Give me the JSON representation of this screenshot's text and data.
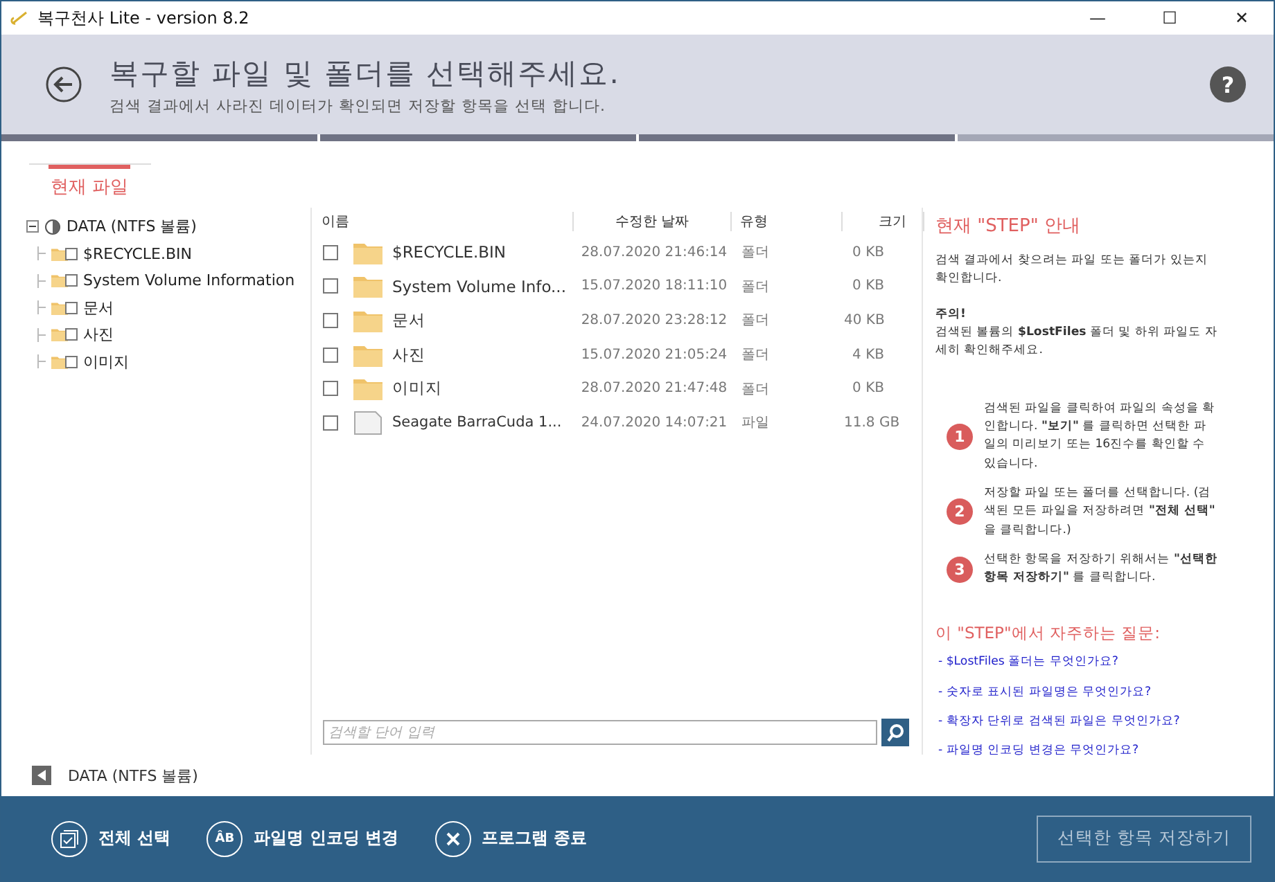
{
  "window": {
    "title": "복구천사 Lite - version 8.2",
    "controls": [
      "—",
      "☐",
      "✕"
    ]
  },
  "header": {
    "title": "복구할 파일 및 폴더를 선택해주세요.",
    "subtitle": "검색 결과에서 사라진 데이터가 확인되면 저장할 항목을 선택 합니다.",
    "help": "?"
  },
  "progress_steps": [
    {
      "done": true
    },
    {
      "done": true
    },
    {
      "done": true
    },
    {
      "done": false
    }
  ],
  "tabs": [
    {
      "label": "현재 파일",
      "selected": true
    }
  ],
  "tree": {
    "label": "DATA (NTFS 볼륨)",
    "expanded": true,
    "children": [
      {
        "label": "$RECYCLE.BIN",
        "checked": false
      },
      {
        "label": "System Volume Information",
        "checked": false
      },
      {
        "label": "문서",
        "checked": false
      },
      {
        "label": "사진",
        "checked": false
      },
      {
        "label": "이미지",
        "checked": false
      }
    ]
  },
  "table": {
    "columns": [
      "이름",
      "수정한 날짜",
      "유형",
      "크기"
    ],
    "rows": [
      {
        "kind": "folder",
        "checked": false,
        "name": "$RECYCLE.BIN",
        "date": "28.07.2020 21:46:14",
        "type": "폴더",
        "size": "0 KB"
      },
      {
        "kind": "folder",
        "checked": false,
        "name": "System Volume Info...",
        "date": "15.07.2020 18:11:10",
        "type": "폴더",
        "size": "0 KB"
      },
      {
        "kind": "folder",
        "checked": false,
        "name": "문서",
        "date": "28.07.2020 23:28:12",
        "type": "폴더",
        "size": "40 KB"
      },
      {
        "kind": "folder",
        "checked": false,
        "name": "사진",
        "date": "15.07.2020 21:05:24",
        "type": "폴더",
        "size": "4 KB"
      },
      {
        "kind": "folder",
        "checked": false,
        "name": "이미지",
        "date": "28.07.2020 21:47:48",
        "type": "폴더",
        "size": "0 KB"
      },
      {
        "kind": "file",
        "checked": false,
        "name": "Seagate BarraCuda 1...",
        "date": "24.07.2020 14:07:21",
        "type": "파일",
        "size": "11.8 GB"
      }
    ]
  },
  "search": {
    "placeholder": "검색할 단어 입력"
  },
  "guide": {
    "title": "현재 \"STEP\" 안내",
    "intro": "검색 결과에서 찾으려는 파일 또는 폴더가 있는지 확인합니다.",
    "note_title": "주의!",
    "note": "검색된 볼륨의 **$LostFiles** 폴더 및 하위 파일도 자세히 확인해주세요.",
    "steps": [
      {
        "number": "1",
        "text": "검색된 파일을 클릭하여 파일의 속성을 확인합니다. **\"보기\"** 를 클릭하면 선택한 파일의 미리보기 또는 16진수를 확인할 수 있습니다."
      },
      {
        "number": "2",
        "text": "저장할 파일 또는 폴더를 선택합니다. (검색된 모든 파일을 저장하려면 **\"전체 선택\"** 을 클릭합니다.)"
      },
      {
        "number": "3",
        "text": "선택한 항목을 저장하기 위해서는 **\"선택한 항목 저장하기\"** 를 클릭합니다."
      }
    ],
    "faq_title": "이 \"STEP\"에서 자주하는 질문:",
    "faq": [
      "- $LostFiles 폴더는 무엇인가요?",
      "- 숫자로 표시된 파일명은 무엇인가요?",
      "- 확장자 단위로 검색된 파일은 무엇인가요?",
      "- 파일명 인코딩 변경은 무엇인가요?"
    ]
  },
  "breadcrumb": "DATA (NTFS 볼륨)",
  "footer": {
    "actions": [
      {
        "kind": "select_all",
        "label": "전체 선택"
      },
      {
        "kind": "encoding",
        "label": "파일명 인코딩 변경",
        "icon_text": "ÂB"
      },
      {
        "kind": "exit",
        "label": "프로그램 종료"
      }
    ],
    "save": {
      "label": "선택한 항목 저장하기",
      "disabled": true
    }
  }
}
